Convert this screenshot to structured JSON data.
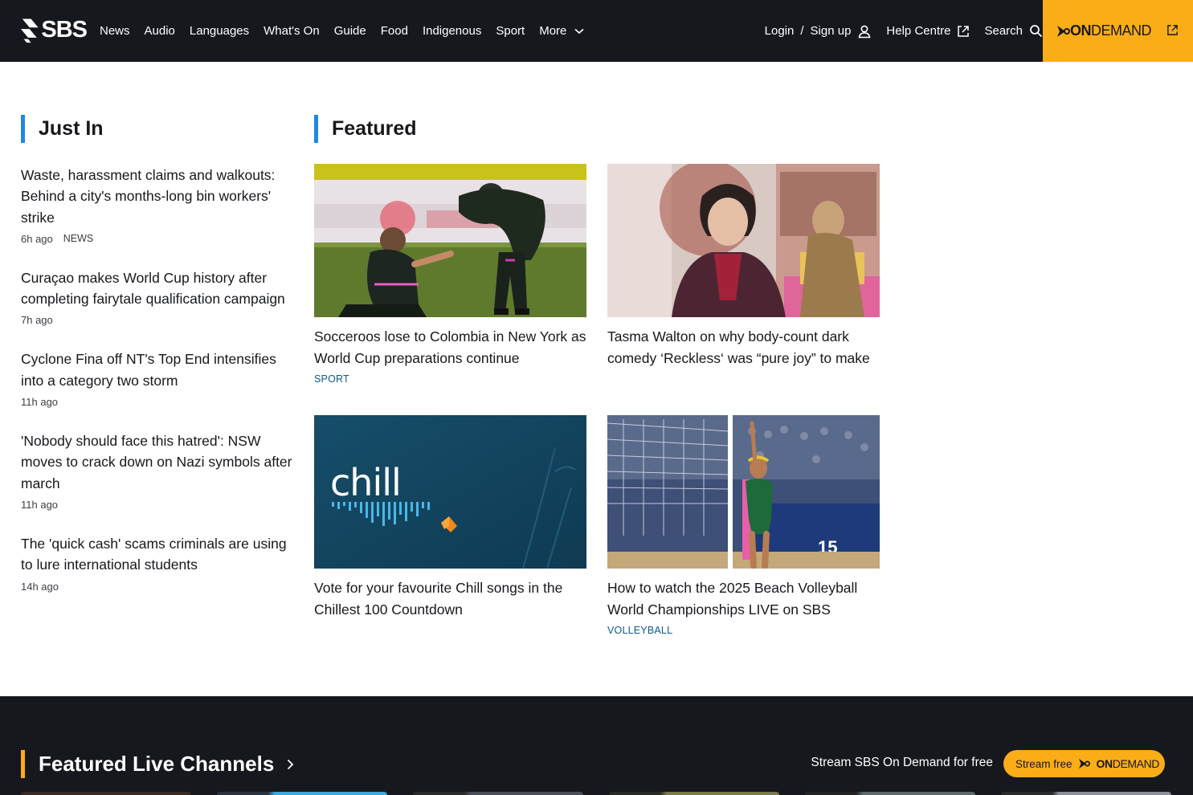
{
  "header": {
    "logo_text": "SBS",
    "nav": [
      "News",
      "Audio",
      "Languages",
      "What's On",
      "Guide",
      "Food",
      "Indigenous",
      "Sport",
      "More"
    ],
    "login": "Login",
    "separator": "/",
    "signup": "Sign up",
    "help": "Help Centre",
    "search": "Search",
    "ondemand_bold": "ON",
    "ondemand_rest": "DEMAND"
  },
  "just_in": {
    "heading": "Just In",
    "items": [
      {
        "title": "Waste, harassment claims and walkouts: Behind a city's months-long bin workers' strike",
        "time": "6h ago",
        "category": "NEWS"
      },
      {
        "title": "Curaçao makes World Cup history after completing fairytale qualification campaign",
        "time": "7h ago",
        "category": ""
      },
      {
        "title": "Cyclone Fina off NT's Top End intensifies into a category two storm",
        "time": "11h ago",
        "category": ""
      },
      {
        "title": "'Nobody should face this hatred': NSW moves to crack down on Nazi symbols after march",
        "time": "11h ago",
        "category": ""
      },
      {
        "title": "The 'quick cash' scams criminals are using to lure international students",
        "time": "14h ago",
        "category": ""
      }
    ]
  },
  "featured": {
    "heading": "Featured",
    "cards": [
      {
        "title": "Socceroos lose to Colombia in New York as World Cup preparations continue",
        "tag": "SPORT"
      },
      {
        "title": "Tasma Walton on why body-count dark comedy ‘Reckless‘ was “pure joy” to make",
        "tag": ""
      },
      {
        "title": "Vote for your favourite Chill songs in the Chillest 100 Countdown",
        "tag": "",
        "logo_text": "chill"
      },
      {
        "title": "How to watch the 2025 Beach Volleyball World Championships LIVE on SBS",
        "tag": "VOLLEYBALL",
        "scoreboard": "15"
      }
    ]
  },
  "live": {
    "heading": "Featured Live Channels",
    "stream_text": "Stream SBS On Demand for free",
    "stream_btn": "Stream free",
    "od_bold": "ON",
    "od_rest": "DEMAND"
  },
  "colors": {
    "topbar": "#16181d",
    "accent_blue": "#1e89e0",
    "ondemand_yellow": "#fbad18",
    "tag_blue": "#0d5a8a"
  },
  "icons": [
    "sbs-logo-icon",
    "chevron-down-icon",
    "user-icon",
    "external-link-icon",
    "search-icon",
    "chevron-right-icon"
  ]
}
